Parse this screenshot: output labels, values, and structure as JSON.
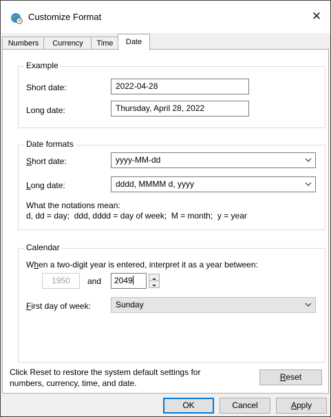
{
  "window": {
    "title": "Customize Format",
    "close_glyph": "✕",
    "icon": "globe-clock-icon"
  },
  "tabs": [
    {
      "label": "Numbers",
      "active": false
    },
    {
      "label": "Currency",
      "active": false
    },
    {
      "label": "Time",
      "active": false
    },
    {
      "label": "Date",
      "active": true
    }
  ],
  "example": {
    "title": "Example",
    "short_label": "Short date:",
    "short_value": "2022-04-28",
    "long_label": "Long date:",
    "long_value": "Thursday, April 28, 2022"
  },
  "date_formats": {
    "title": "Date formats",
    "short_label_mnemonic": "S",
    "short_label_rest": "hort date:",
    "short_value": "yyyy-MM-dd",
    "long_label_mnemonic": "L",
    "long_label_rest": "ong date:",
    "long_value": "dddd, MMMM d, yyyy",
    "notation_title": "What the notations mean:",
    "notation_text": "d, dd = day;  ddd, dddd = day of week;  M = month;  y = year"
  },
  "calendar": {
    "title": "Calendar",
    "two_digit_pre": "W",
    "two_digit_mnemonic": "h",
    "two_digit_rest": "en a two-digit year is entered, interpret it as a year between:",
    "from_year": "1950",
    "and_label": "and",
    "to_year": "2049",
    "first_day_mnemonic": "F",
    "first_day_rest": "irst day of week:",
    "first_day_value": "Sunday"
  },
  "reset": {
    "text_line1": "Click Reset to restore the system default settings for",
    "text_line2": "numbers, currency, time, and date.",
    "button_mnemonic": "R",
    "button_rest": "eset"
  },
  "footer": {
    "ok_label": "OK",
    "cancel_label": "Cancel",
    "apply_mnemonic": "A",
    "apply_rest": "pply"
  },
  "colors": {
    "accent": "#0078d7",
    "panel_bg": "#ffffff",
    "dialog_bg": "#f0f0f0"
  }
}
